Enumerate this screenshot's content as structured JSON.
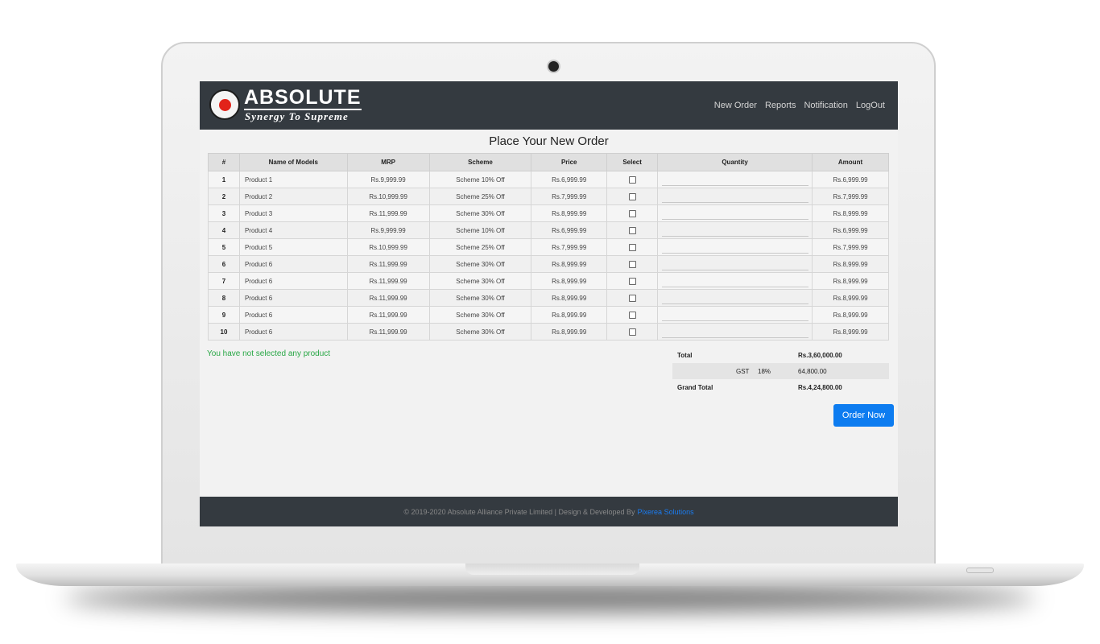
{
  "brand": {
    "name": "ABSOLUTE",
    "tagline": "Synergy To Supreme",
    "logo_text": "ABSOLUTE"
  },
  "nav": {
    "items": [
      "New Order",
      "Reports",
      "Notification",
      "LogOut"
    ]
  },
  "page": {
    "title": "Place Your New Order"
  },
  "table": {
    "headers": [
      "#",
      "Name of Models",
      "MRP",
      "Scheme",
      "Price",
      "Select",
      "Quantity",
      "Amount"
    ],
    "rows": [
      {
        "idx": "1",
        "model": "Product 1",
        "mrp": "Rs.9,999.99",
        "scheme": "Scheme 10% Off",
        "price": "Rs.6,999.99",
        "amount": "Rs.6,999.99"
      },
      {
        "idx": "2",
        "model": "Product 2",
        "mrp": "Rs.10,999.99",
        "scheme": "Scheme 25% Off",
        "price": "Rs.7,999.99",
        "amount": "Rs.7,999.99"
      },
      {
        "idx": "3",
        "model": "Product 3",
        "mrp": "Rs.11,999.99",
        "scheme": "Scheme 30% Off",
        "price": "Rs.8,999.99",
        "amount": "Rs.8,999.99"
      },
      {
        "idx": "4",
        "model": "Product 4",
        "mrp": "Rs.9,999.99",
        "scheme": "Scheme 10% Off",
        "price": "Rs.6,999.99",
        "amount": "Rs.6,999.99"
      },
      {
        "idx": "5",
        "model": "Product 5",
        "mrp": "Rs.10,999.99",
        "scheme": "Scheme 25% Off",
        "price": "Rs.7,999.99",
        "amount": "Rs.7,999.99"
      },
      {
        "idx": "6",
        "model": "Product 6",
        "mrp": "Rs.11,999.99",
        "scheme": "Scheme 30% Off",
        "price": "Rs.8,999.99",
        "amount": "Rs.8,999.99"
      },
      {
        "idx": "7",
        "model": "Product 6",
        "mrp": "Rs.11,999.99",
        "scheme": "Scheme 30% Off",
        "price": "Rs.8,999.99",
        "amount": "Rs.8,999.99"
      },
      {
        "idx": "8",
        "model": "Product 6",
        "mrp": "Rs.11,999.99",
        "scheme": "Scheme 30% Off",
        "price": "Rs.8,999.99",
        "amount": "Rs.8,999.99"
      },
      {
        "idx": "9",
        "model": "Product 6",
        "mrp": "Rs.11,999.99",
        "scheme": "Scheme 30% Off",
        "price": "Rs.8,999.99",
        "amount": "Rs.8,999.99"
      },
      {
        "idx": "10",
        "model": "Product 6",
        "mrp": "Rs.11,999.99",
        "scheme": "Scheme 30% Off",
        "price": "Rs.8,999.99",
        "amount": "Rs.8,999.99"
      }
    ]
  },
  "message": "You have not selected any product",
  "totals": {
    "total_label": "Total",
    "total_value": "Rs.3,60,000.00",
    "gst_label": "GST",
    "gst_rate": "18%",
    "gst_value": "64,800.00",
    "grand_label": "Grand Total",
    "grand_value": "Rs.4,24,800.00"
  },
  "order_button": "Order Now",
  "footer": {
    "text": "© 2019-2020 Absolute Alliance Private Limited | Design & Developed By",
    "link": "Pixerea Solutions"
  },
  "colors": {
    "navbar": "#343a40",
    "primary": "#0d7cf0",
    "success": "#28a745",
    "brand_red": "#e2231a"
  }
}
